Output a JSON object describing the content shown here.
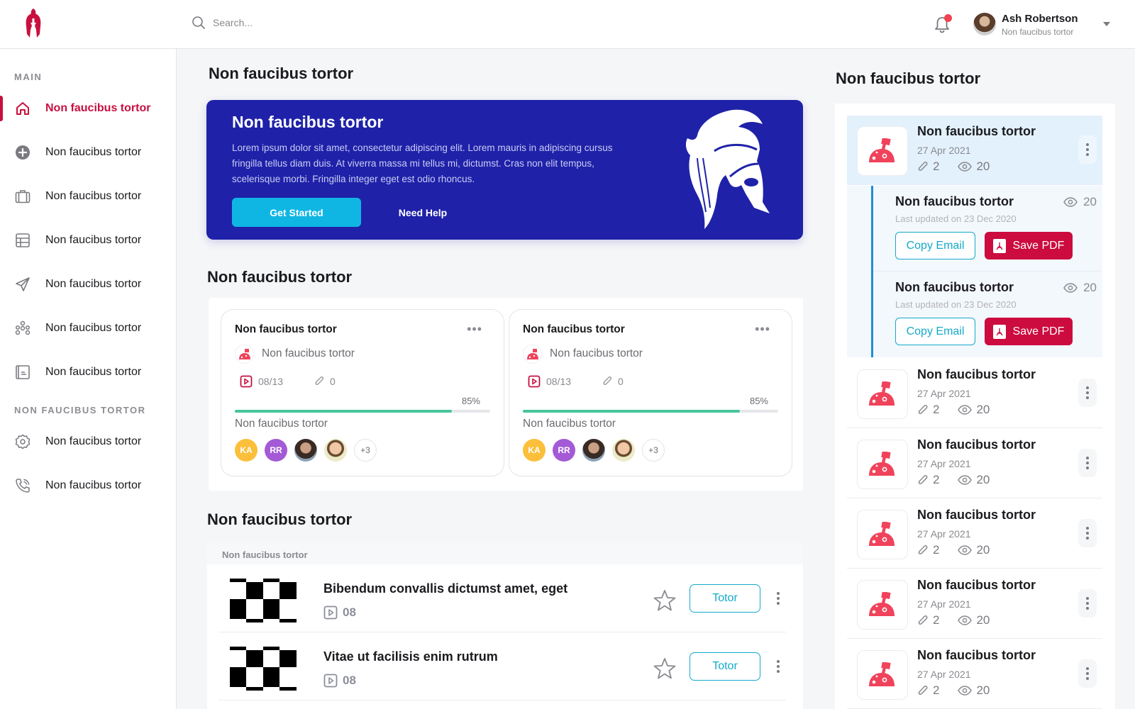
{
  "header": {
    "search_placeholder": "Search...",
    "user": {
      "name": "Ash Robertson",
      "role": "Non faucibus tortor"
    },
    "notifications_unread": true
  },
  "sidebar": {
    "sections": [
      {
        "label": "MAIN"
      },
      {
        "label": "NON FAUCIBUS TORTOR"
      }
    ],
    "items": [
      {
        "label": "Non faucibus tortor",
        "icon": "home-icon",
        "active": true
      },
      {
        "label": "Non faucibus tortor",
        "icon": "plus-circle-icon"
      },
      {
        "label": "Non faucibus tortor",
        "icon": "briefcase-icon"
      },
      {
        "label": "Non faucibus tortor",
        "icon": "table-icon"
      },
      {
        "label": "Non faucibus tortor",
        "icon": "paper-plane-icon"
      },
      {
        "label": "Non faucibus tortor",
        "icon": "network-icon"
      },
      {
        "label": "Non faucibus tortor",
        "icon": "newspaper-icon"
      },
      {
        "label": "Non faucibus tortor",
        "icon": "gear-icon"
      },
      {
        "label": "Non faucibus tortor",
        "icon": "phone-call-icon"
      }
    ]
  },
  "main": {
    "page_title": "Non faucibus tortor",
    "hero": {
      "title": "Non faucibus tortor",
      "text": "Lorem ipsum dolor sit amet, consectetur adipiscing elit. Lorem mauris in adipiscing cursus fringilla tellus diam duis. At viverra massa mi tellus mi, dictumst. Cras non elit tempus, scelerisque morbi. Fringilla integer eget est odio rhoncus.",
      "primary_button": "Get Started",
      "secondary_button": "Need Help"
    },
    "courses_title": "Non faucibus tortor",
    "courses": [
      {
        "title": "Non faucibus tortor",
        "subtitle": "Non faucibus tortor",
        "videos": "08/13",
        "attachments": "0",
        "progress_label": "85%",
        "progress": 0.85,
        "members_label": "Non faucibus tortor",
        "avatars": [
          "KA",
          "RR",
          "",
          ""
        ],
        "more_count": "+3"
      },
      {
        "title": "Non faucibus tortor",
        "subtitle": "Non faucibus tortor",
        "videos": "08/13",
        "attachments": "0",
        "progress_label": "85%",
        "progress": 0.85,
        "members_label": "Non faucibus tortor",
        "avatars": [
          "KA",
          "RR",
          "",
          ""
        ],
        "more_count": "+3"
      }
    ],
    "lessons_title": "Non faucibus tortor",
    "lessons_label": "Non faucibus tortor",
    "lessons": [
      {
        "title": "Bibendum convallis dictumst amet, eget",
        "videos": "08",
        "button": "Totor"
      },
      {
        "title": "Vitae ut facilisis enim rutrum",
        "videos": "08",
        "button": "Totor"
      }
    ]
  },
  "right_panel": {
    "title": "Non faucibus tortor",
    "active_item": {
      "title": "Non faucibus tortor",
      "date": "27 Apr 2021",
      "attachments": "2",
      "views": "20"
    },
    "sub_items": [
      {
        "title": "Non faucibus tortor",
        "views": "20",
        "updated": "Last updated on 23 Dec 2020",
        "copy_label": "Copy Email",
        "pdf_label": "Save PDF"
      },
      {
        "title": "Non faucibus tortor",
        "views": "20",
        "updated": "Last updated on 23 Dec 2020",
        "copy_label": "Copy Email",
        "pdf_label": "Save PDF"
      }
    ],
    "items": [
      {
        "title": "Non faucibus tortor",
        "date": "27 Apr 2021",
        "attachments": "2",
        "views": "20"
      },
      {
        "title": "Non faucibus tortor",
        "date": "27 Apr 2021",
        "attachments": "2",
        "views": "20"
      },
      {
        "title": "Non faucibus tortor",
        "date": "27 Apr 2021",
        "attachments": "2",
        "views": "20"
      },
      {
        "title": "Non faucibus tortor",
        "date": "27 Apr 2021",
        "attachments": "2",
        "views": "20"
      },
      {
        "title": "Non faucibus tortor",
        "date": "27 Apr 2021",
        "attachments": "2",
        "views": "20"
      }
    ]
  },
  "colors": {
    "brand": "#c8103f",
    "hero_bg": "#1f22a8",
    "primary_button": "#10b6e3",
    "accent_outline": "#14a9c9",
    "progress": "#47c599",
    "pdf_button": "#cc0b3f",
    "active_row": "#e3f1fc",
    "avatar_ka": "#fbbf3a",
    "avatar_rr": "#a45ad6"
  }
}
